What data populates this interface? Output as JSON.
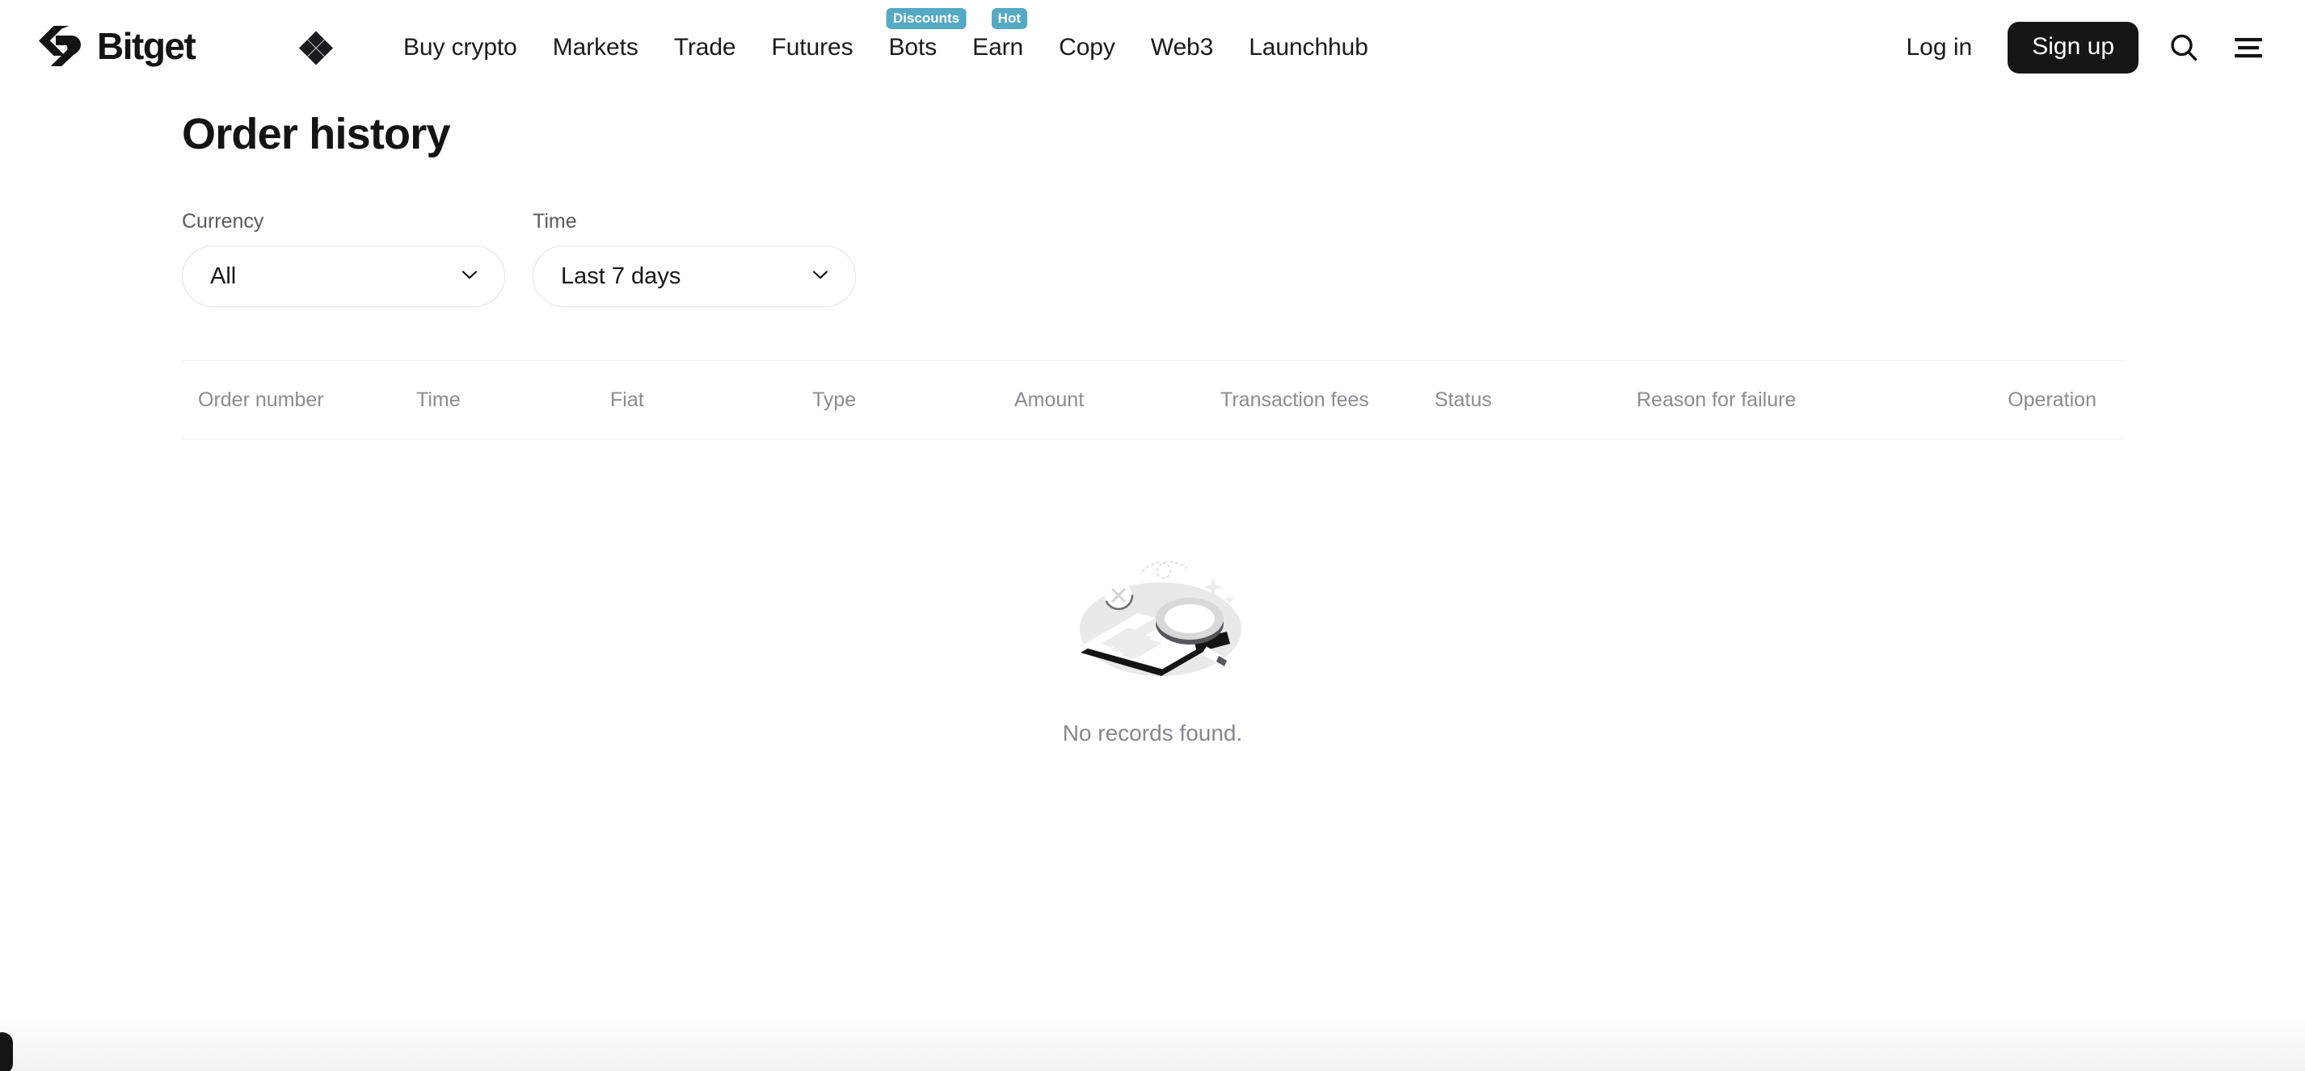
{
  "brand": {
    "name": "Bitget",
    "logo_icon": "bitget-logo",
    "diamond_icon": "bitget-diamond-icon"
  },
  "nav": {
    "items": [
      {
        "label": "Buy crypto",
        "badge": null
      },
      {
        "label": "Markets",
        "badge": null
      },
      {
        "label": "Trade",
        "badge": null
      },
      {
        "label": "Futures",
        "badge": null
      },
      {
        "label": "Bots",
        "badge": "Discounts"
      },
      {
        "label": "Earn",
        "badge": "Hot"
      },
      {
        "label": "Copy",
        "badge": null
      },
      {
        "label": "Web3",
        "badge": null
      },
      {
        "label": "Launchhub",
        "badge": null
      }
    ],
    "login_label": "Log in",
    "signup_label": "Sign up",
    "search_icon": "search-icon",
    "menu_icon": "hamburger-menu-icon",
    "badge_color": "#54a9c3",
    "signup_bg": "#161616"
  },
  "page": {
    "title": "Order history"
  },
  "filters": [
    {
      "label": "Currency",
      "value": "All",
      "chevron_icon": "chevron-down-icon"
    },
    {
      "label": "Time",
      "value": "Last 7 days",
      "chevron_icon": "chevron-down-icon"
    }
  ],
  "table": {
    "columns": [
      "Order number",
      "Time",
      "Fiat",
      "Type",
      "Amount",
      "Transaction fees",
      "Status",
      "Reason for failure",
      "Operation"
    ],
    "rows": []
  },
  "empty_state": {
    "illustration_icon": "no-records-document-magnifier-illustration",
    "message": "No records found."
  }
}
